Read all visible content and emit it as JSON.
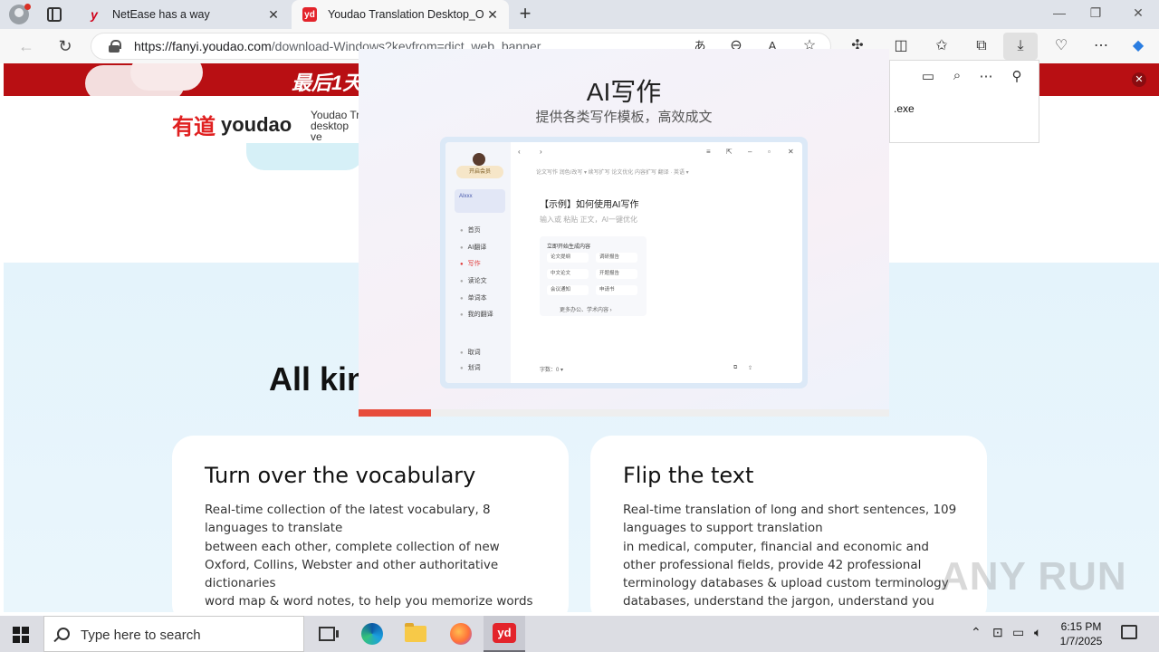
{
  "browser": {
    "tabs": [
      {
        "title": "NetEase has a way",
        "favicon": "y"
      },
      {
        "title": "Youdao Translation Desktop_Offi",
        "favicon": "yd"
      }
    ],
    "url_host": "https://fanyi.youdao.com",
    "url_path": "/download-Windows?keyfrom=dict_web_banner",
    "icons": [
      "back-icon",
      "refresh-icon",
      "translate-icon",
      "zoom-out-icon",
      "read-aloud-icon",
      "favorite-icon",
      "extensions-icon",
      "split-screen-icon",
      "favorites-icon",
      "collections-icon",
      "downloads-icon",
      "browser-essentials-icon",
      "more-icon",
      "copilot-icon"
    ]
  },
  "download_panel": {
    "file": ".exe"
  },
  "page": {
    "promo_text": "最后1天",
    "logo_cn": "有道",
    "logo_en": "youdao",
    "header_desc_line1": "Youdao Tr",
    "header_desc_line2": "desktop ve",
    "hero_title": "All kin",
    "cards": [
      {
        "title": "Turn over the vocabulary",
        "lines": [
          "Real-time collection of the latest vocabulary, 8 languages to translate",
          "between each other, complete collection of new Oxford, Collins, Webster and other authoritative dictionaries",
          "word map & word notes, to help you memorize words scientifically and efficiently"
        ]
      },
      {
        "title": "Flip the text",
        "lines": [
          "Real-time translation of long and short sentences, 109 languages to support translation",
          "in medical, computer, financial and economic and other professional fields, provide 42 professional terminology databases & upload custom terminology databases, understand the jargon, understand you better"
        ]
      }
    ]
  },
  "overlay": {
    "title": "AI写作",
    "subtitle": "提供各类写作模板，高效成文",
    "progress": 0.137,
    "mock": {
      "pill": "开启会员",
      "box_label": "AIxxx",
      "nav": [
        "首页",
        "AI翻译",
        "写作",
        "读论文",
        "单词本",
        "我的翻译"
      ],
      "nav_active": 2,
      "bottom_nav": [
        "取词",
        "划词"
      ],
      "topbar": "论文写作   润色/改写 ▾   续写扩写   论文优化   内容扩写   翻译 · 英语 ▾",
      "heading": "【示例】如何使用AI写作",
      "placeholder": "输入或 粘贴 正文，AI一键优化",
      "panel_title": "立即开始生成内容",
      "chips": [
        "论文提纲",
        "调研报告",
        "中文论文",
        "开题报告",
        "会议通知",
        "申请书"
      ],
      "more": "更多办公、学术内容 ›",
      "bottom_left": "字数：0 ▾"
    }
  },
  "taskbar": {
    "search_placeholder": "Type here to search",
    "time": "6:15 PM",
    "date": "1/7/2025"
  },
  "watermark": "ANY RUN"
}
